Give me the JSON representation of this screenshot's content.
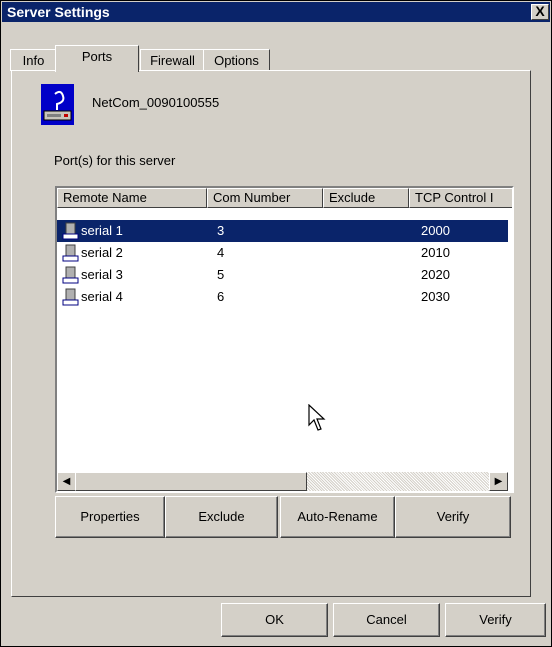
{
  "window": {
    "title": "Server Settings",
    "close_label": "X"
  },
  "tabs": [
    {
      "label": "Info",
      "active": false
    },
    {
      "label": "Ports",
      "active": true
    },
    {
      "label": "Firewall",
      "active": false
    },
    {
      "label": "Options",
      "active": false
    }
  ],
  "server": {
    "name": "NetCom_0090100555",
    "icon": "netcom-server-icon"
  },
  "ports_label": "Port(s) for this server",
  "list": {
    "columns": [
      "Remote Name",
      "Com Number",
      "Exclude",
      "TCP Control I"
    ],
    "rows": [
      {
        "name": "serial 1",
        "com": "3",
        "exclude": "",
        "tcp": "2000",
        "selected": true
      },
      {
        "name": "serial 2",
        "com": "4",
        "exclude": "",
        "tcp": "2010",
        "selected": false
      },
      {
        "name": "serial 3",
        "com": "5",
        "exclude": "",
        "tcp": "2020",
        "selected": false
      },
      {
        "name": "serial 4",
        "com": "6",
        "exclude": "",
        "tcp": "2030",
        "selected": false
      }
    ]
  },
  "actions": {
    "properties": "Properties",
    "exclude": "Exclude",
    "auto_rename": "Auto-Rename",
    "verify": "Verify"
  },
  "footer": {
    "ok": "OK",
    "cancel": "Cancel",
    "verify": "Verify"
  },
  "colors": {
    "titlebar": "#0a246a",
    "selection": "#0a246a",
    "face": "#d4d0c8"
  }
}
